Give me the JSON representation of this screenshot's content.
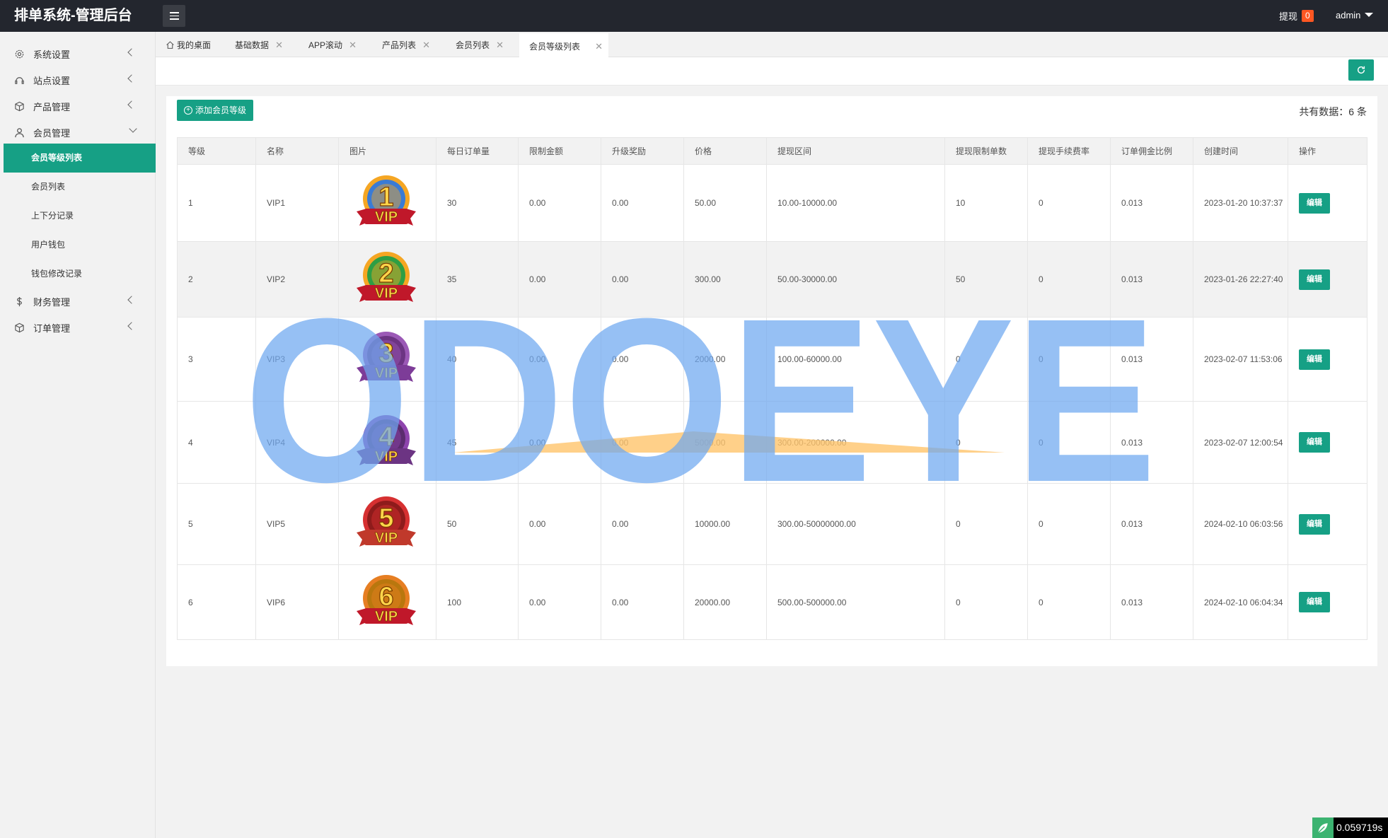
{
  "app": {
    "title": "排单系统-管理后台"
  },
  "header": {
    "withdraw_label": "提现",
    "withdraw_count": "0",
    "user": "admin"
  },
  "sidebar": {
    "items": [
      {
        "label": "系统设置",
        "icon": "gear-icon"
      },
      {
        "label": "站点设置",
        "icon": "site-icon"
      },
      {
        "label": "产品管理",
        "icon": "cube-icon"
      },
      {
        "label": "会员管理",
        "icon": "user-icon"
      },
      {
        "label": "财务管理",
        "icon": "dollar-icon"
      },
      {
        "label": "订单管理",
        "icon": "cube-icon"
      }
    ],
    "subitems": [
      "会员等级列表",
      "会员列表",
      "上下分记录",
      "用户钱包",
      "钱包修改记录"
    ]
  },
  "tabs": [
    "我的桌面",
    "基础数据",
    "APP滚动",
    "产品列表",
    "会员列表",
    "会员等级列表"
  ],
  "toolbar": {
    "add_label": "添加会员等级",
    "total_label": "共有数据：6 条"
  },
  "table": {
    "headers": [
      "等级",
      "名称",
      "图片",
      "每日订单量",
      "限制金额",
      "升级奖励",
      "价格",
      "提现区间",
      "提现限制单数",
      "提现手续费率",
      "订单佣金比例",
      "创建时间",
      "操作"
    ],
    "rows": [
      {
        "level": "1",
        "name": "VIP1",
        "badge": "1",
        "orders": "30",
        "limit": "0.00",
        "reward": "0.00",
        "price": "50.00",
        "range": "10.00-10000.00",
        "wlimit": "10",
        "fee": "0",
        "comm": "0.013",
        "time": "2023-01-20 10:37:37",
        "op": "编辑"
      },
      {
        "level": "2",
        "name": "VIP2",
        "badge": "2",
        "orders": "35",
        "limit": "0.00",
        "reward": "0.00",
        "price": "300.00",
        "range": "50.00-30000.00",
        "wlimit": "50",
        "fee": "0",
        "comm": "0.013",
        "time": "2023-01-26 22:27:40",
        "op": "编辑"
      },
      {
        "level": "3",
        "name": "VIP3",
        "badge": "3",
        "orders": "40",
        "limit": "0.00",
        "reward": "0.00",
        "price": "2000.00",
        "range": "100.00-60000.00",
        "wlimit": "0",
        "fee": "0",
        "comm": "0.013",
        "time": "2023-02-07 11:53:06",
        "op": "编辑"
      },
      {
        "level": "4",
        "name": "VIP4",
        "badge": "4",
        "orders": "45",
        "limit": "0.00",
        "reward": "0.00",
        "price": "5000.00",
        "range": "300.00-200000.00",
        "wlimit": "0",
        "fee": "0",
        "comm": "0.013",
        "time": "2023-02-07 12:00:54",
        "op": "编辑"
      },
      {
        "level": "5",
        "name": "VIP5",
        "badge": "5",
        "orders": "50",
        "limit": "0.00",
        "reward": "0.00",
        "price": "10000.00",
        "range": "300.00-50000000.00",
        "wlimit": "0",
        "fee": "0",
        "comm": "0.013",
        "time": "2024-02-10 06:03:56",
        "op": "编辑"
      },
      {
        "level": "6",
        "name": "VIP6",
        "badge": "6",
        "orders": "100",
        "limit": "0.00",
        "reward": "0.00",
        "price": "20000.00",
        "range": "500.00-500000.00",
        "wlimit": "0",
        "fee": "0",
        "comm": "0.013",
        "time": "2024-02-10 06:04:34",
        "op": "编辑"
      }
    ]
  },
  "watermark": {
    "text": "ODOEYE"
  },
  "timer": {
    "value": "0.059719s"
  },
  "colors": {
    "accent": "#16a085",
    "topbar": "#23262e",
    "badge": "#ff5722"
  }
}
